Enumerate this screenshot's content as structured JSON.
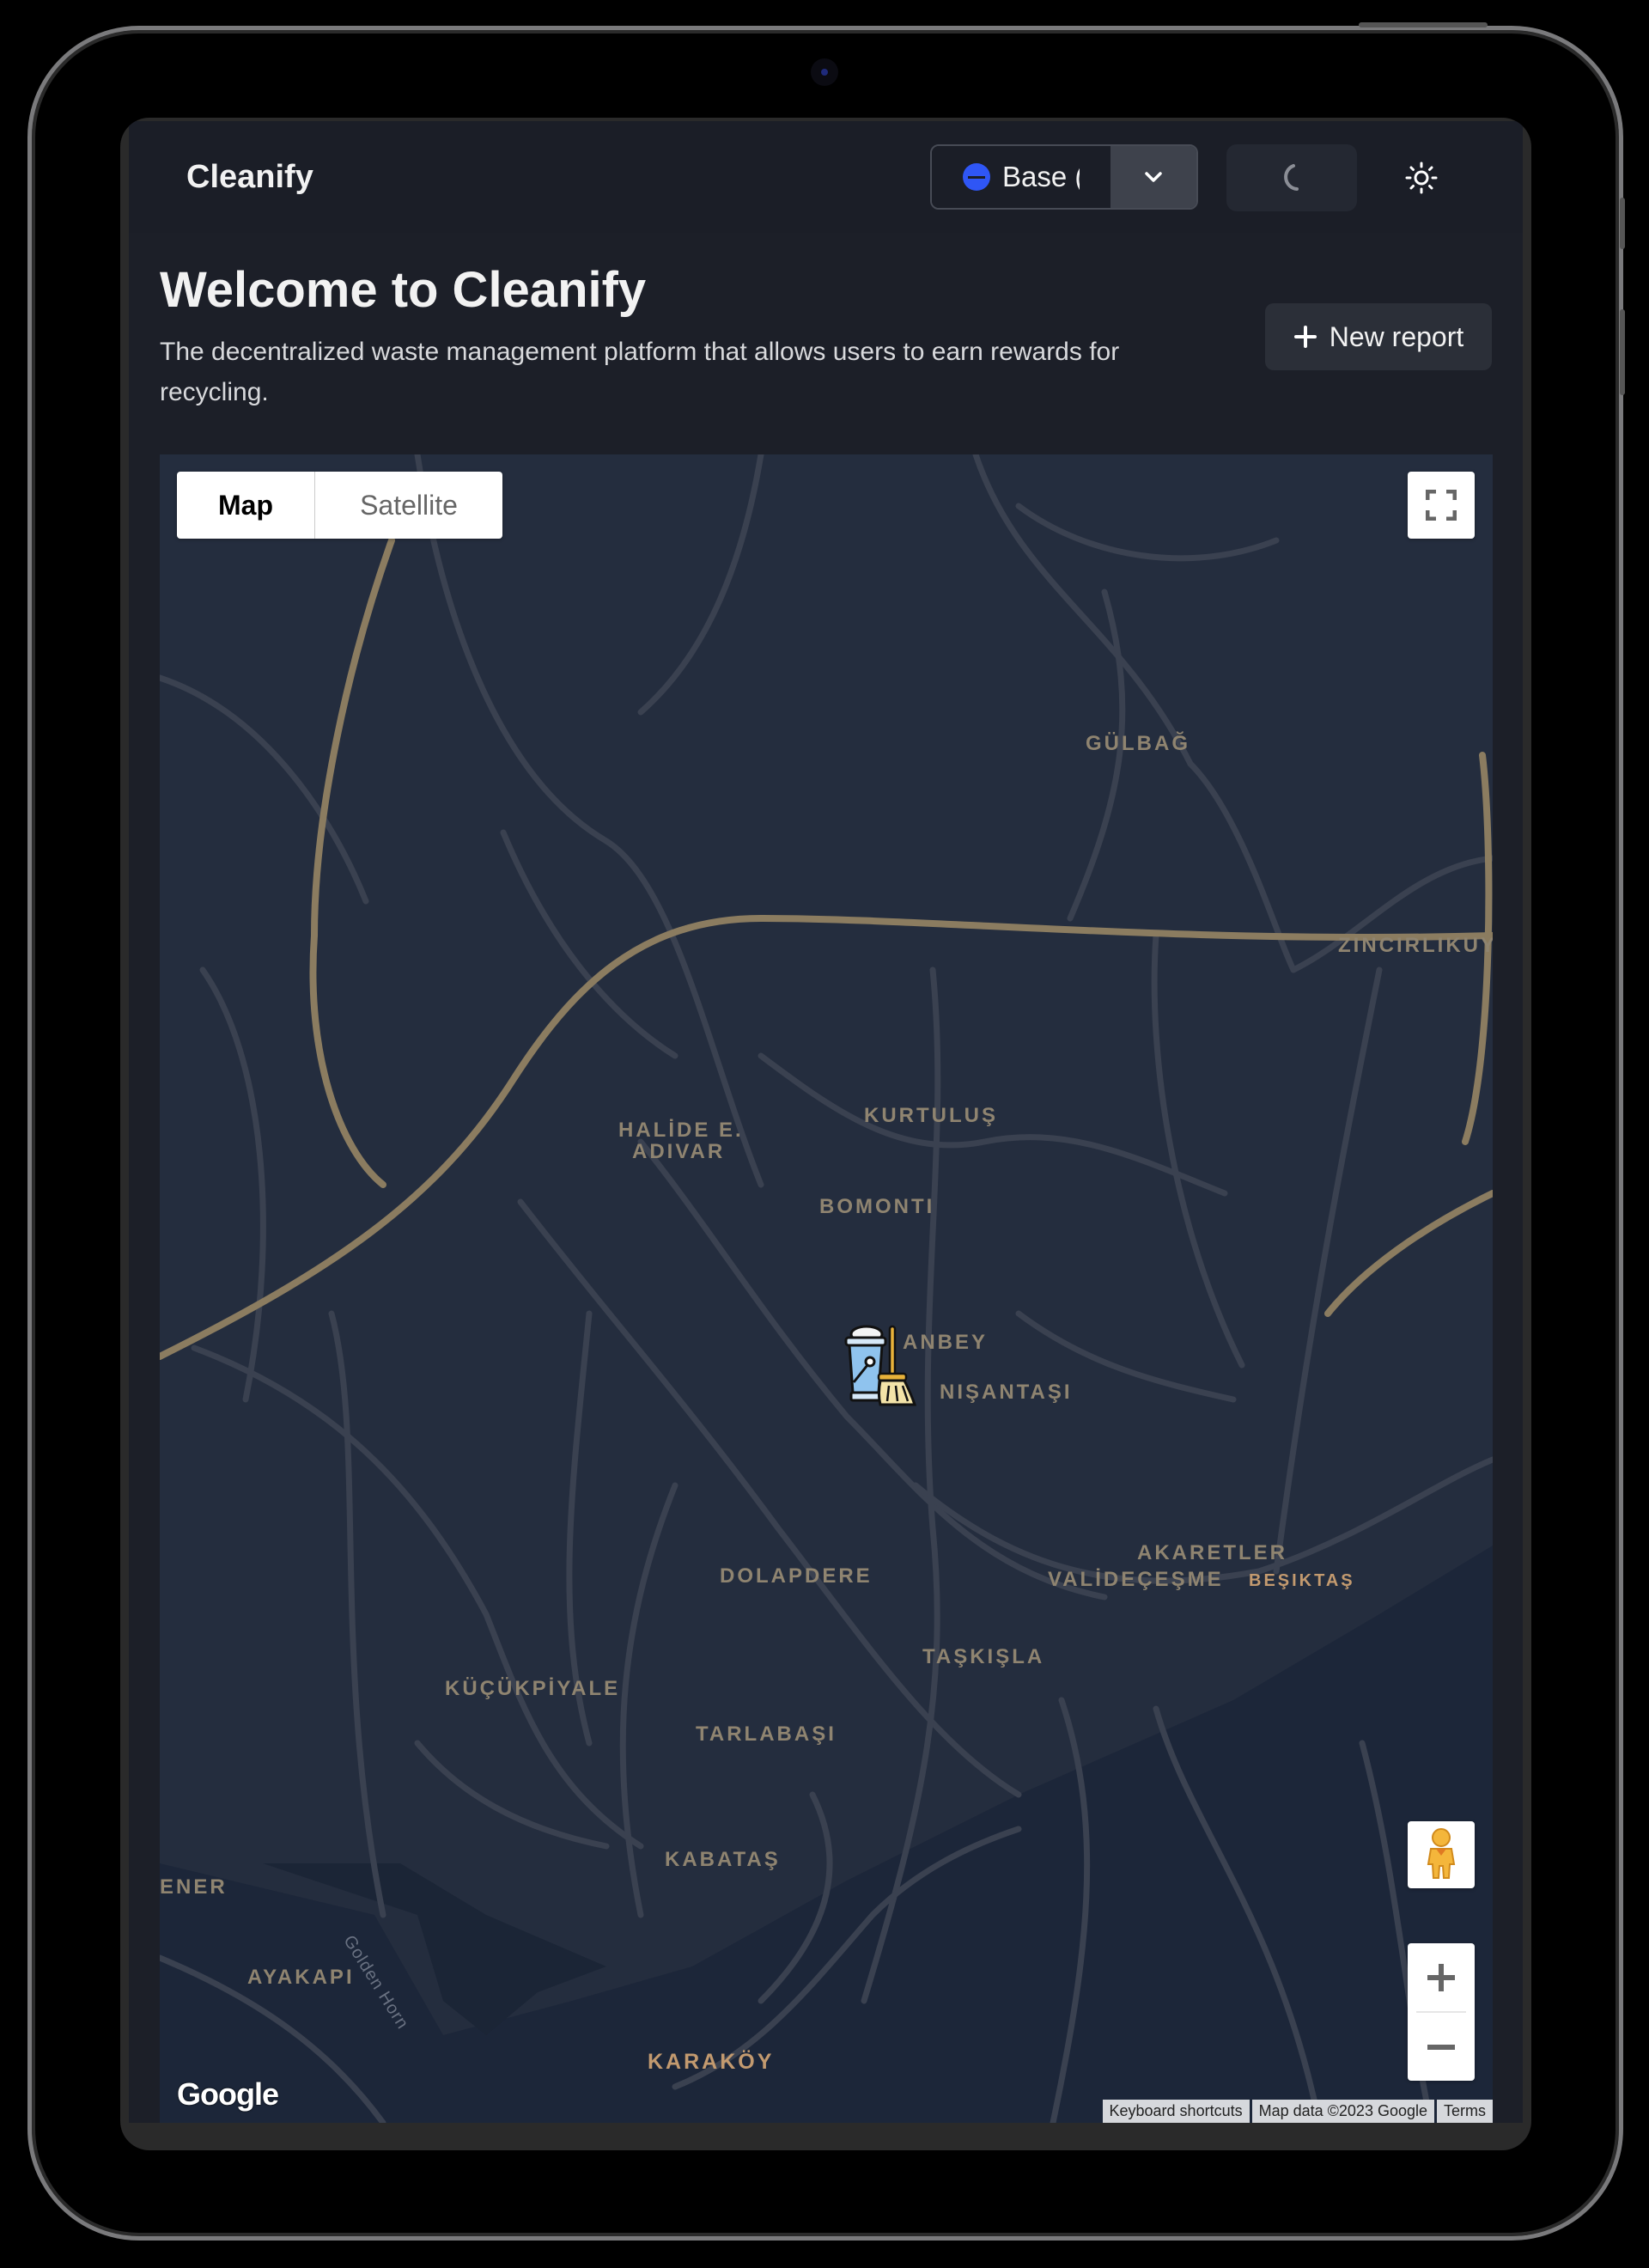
{
  "app": {
    "brand": "Cleanify",
    "network_selector": {
      "label": "Base (",
      "icon": "base-network-icon",
      "color": "#2f56f5"
    },
    "account_button": {
      "state": "loading",
      "icon": "spinner-icon"
    },
    "theme_toggle": {
      "icon": "sun-icon"
    }
  },
  "hero": {
    "title": "Welcome to Cleanify",
    "description": "The decentralized waste management platform that allows users to earn rewards for recycling.",
    "new_report_label": "New report"
  },
  "map": {
    "type_control": {
      "map_label": "Map",
      "satellite_label": "Satellite",
      "selected": "Map"
    },
    "labels": {
      "gulbag": "GÜLBAĞ",
      "zincirlikuyu": "ZINCIRLIKUY",
      "halide_1": "HALİDE E.",
      "halide_2": "ADIVAR",
      "kurtulus": "KURTULUŞ",
      "bomonti": "BOMONTI",
      "anbey": "ANBEY",
      "nisantasi": "NIŞANTAŞI",
      "akaretler": "AKARETLER",
      "valide": "VALİDEÇEŞME",
      "besiktas": "BEŞIKTAŞ",
      "dolapdere": "DOLAPDERE",
      "taskisla": "TAŞKIŞLA",
      "kucukpiyale": "KÜÇÜKPİYALE",
      "tarlabasi": "TARLABAŞI",
      "kabatas": "KABATAŞ",
      "fener": "ENER",
      "ayakapi": "AYAKAPI",
      "golden_horn": "Golden Horn",
      "karakoy": "KARAKÖY"
    },
    "logo": "Google",
    "attribution": {
      "shortcuts": "Keyboard shortcuts",
      "data": "Map data ©2023 Google",
      "terms": "Terms"
    },
    "marker": {
      "icon": "cleaning-bucket-broom-icon"
    }
  }
}
